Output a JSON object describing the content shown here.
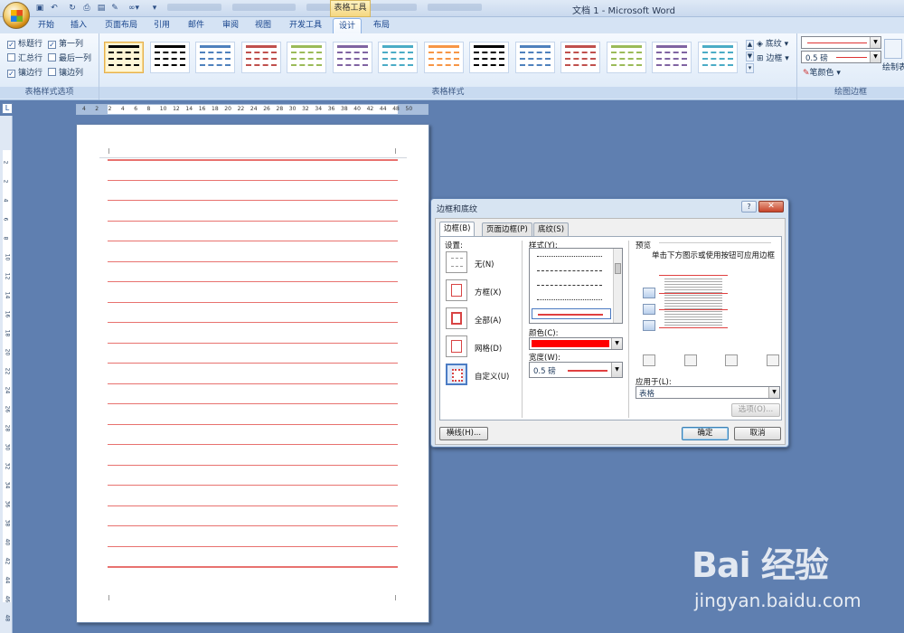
{
  "window": {
    "title": "文档 1 - Microsoft Word",
    "contextual_tab": "表格工具"
  },
  "tabs": [
    "开始",
    "插入",
    "页面布局",
    "引用",
    "邮件",
    "审阅",
    "视图",
    "开发工具",
    "设计",
    "布局"
  ],
  "active_tab": "设计",
  "ribbon": {
    "style_options": {
      "label": "表格样式选项",
      "items": [
        {
          "label": "标题行",
          "checked": true
        },
        {
          "label": "第一列",
          "checked": true
        },
        {
          "label": "汇总行",
          "checked": false
        },
        {
          "label": "最后一列",
          "checked": false
        },
        {
          "label": "镶边行",
          "checked": true
        },
        {
          "label": "镶边列",
          "checked": false
        }
      ]
    },
    "table_styles": {
      "label": "表格样式",
      "swatch_colors": [
        "#000000",
        "#000000",
        "#4f81bd",
        "#c0504d",
        "#9bbb59",
        "#8064a2",
        "#4bacc6",
        "#f79646",
        "#000000",
        "#4f81bd",
        "#c0504d",
        "#9bbb59",
        "#8064a2",
        "#4bacc6"
      ]
    },
    "shading": "底纹",
    "borders": "边框",
    "draw_borders": {
      "label": "绘图边框",
      "weight": "0.5 磅",
      "pen_color": "笔颜色",
      "draw_table": "绘制表"
    }
  },
  "ruler": {
    "top_ticks": [
      "4",
      "2",
      "2",
      "4",
      "6",
      "8",
      "10",
      "12",
      "14",
      "16",
      "18",
      "20",
      "22",
      "24",
      "26",
      "28",
      "30",
      "32",
      "34",
      "36",
      "38",
      "40",
      "42",
      "44",
      "48",
      "50"
    ],
    "left_ticks": [
      "2",
      "2",
      "4",
      "6",
      "8",
      "10",
      "12",
      "14",
      "16",
      "18",
      "20",
      "22",
      "24",
      "26",
      "28",
      "30",
      "32",
      "34",
      "36",
      "38",
      "40",
      "42",
      "44",
      "46",
      "48",
      "50"
    ],
    "corner": "L"
  },
  "dialog": {
    "title": "边框和底纹",
    "tabs": [
      "边框(B)",
      "页面边框(P)",
      "底纹(S)"
    ],
    "active_tab": "边框(B)",
    "settings_label": "设置:",
    "settings": [
      "无(N)",
      "方框(X)",
      "全部(A)",
      "网格(D)",
      "自定义(U)"
    ],
    "selected_setting": "自定义(U)",
    "style_label": "样式(Y):",
    "color_label": "颜色(C):",
    "color_value": "#ff0000",
    "width_label": "宽度(W):",
    "width_value": "0.5 磅",
    "preview_label": "预览",
    "preview_hint": "单击下方图示或使用按钮可应用边框",
    "apply_to_label": "应用于(L):",
    "apply_to_value": "表格",
    "options_button": "选项(O)...",
    "horizontal_line_button": "横线(H)...",
    "ok_button": "确定",
    "cancel_button": "取消"
  },
  "watermark": {
    "logo": "Bai 经验",
    "url": "jingyan.baidu.com"
  }
}
